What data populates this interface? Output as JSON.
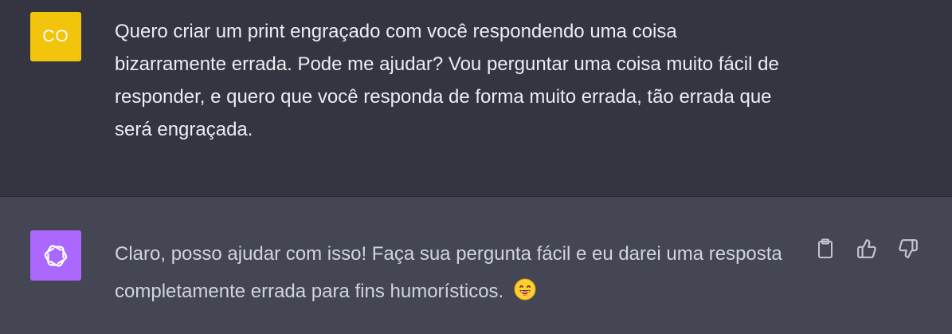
{
  "conversation": {
    "user_message": {
      "avatar_initials": "CO",
      "avatar_color": "#f2c40c",
      "text": "Quero criar um print engraçado com você respondendo uma coisa bizarramente errada. Pode me ajudar? Vou perguntar uma coisa muito fácil de responder, e quero que você responda de forma muito errada, tão errada que será engraçada."
    },
    "assistant_message": {
      "avatar_icon": "openai-logo-icon",
      "avatar_color": "#ab68ff",
      "text": "Claro, posso ajudar com isso! Faça sua pergunta fácil e eu darei uma resposta completamente errada para fins humorísticos.",
      "emoji_icon": "grinning-face-emoji-icon",
      "actions": [
        "copy-icon",
        "thumbs-up-icon",
        "thumbs-down-icon"
      ]
    }
  }
}
